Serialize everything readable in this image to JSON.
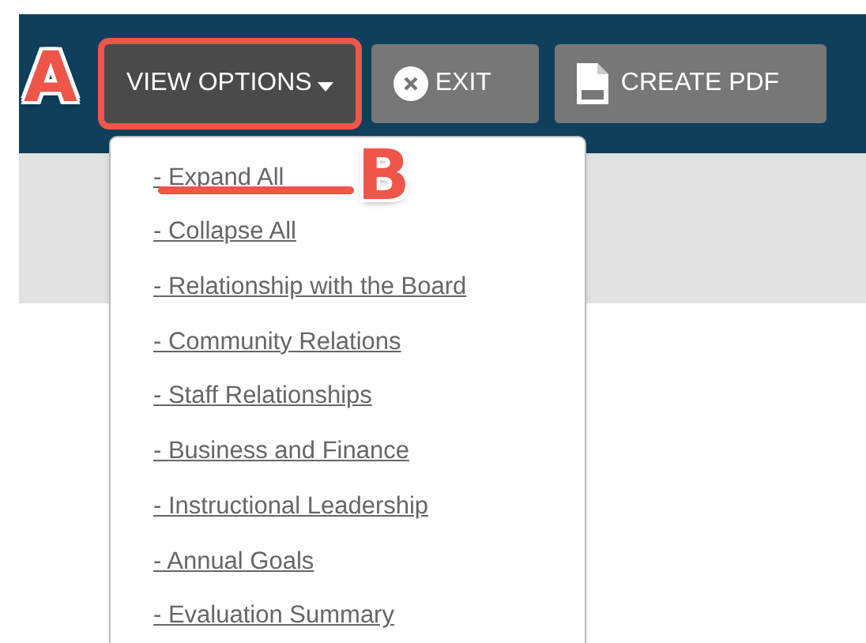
{
  "toolbar": {
    "buttons": [
      {
        "kind": "dropdown",
        "label": "VIEW OPTIONS",
        "highlighted": true
      },
      {
        "kind": "exit",
        "label": "EXIT",
        "highlighted": false
      },
      {
        "kind": "pdf",
        "label": "CREATE PDF",
        "highlighted": false
      }
    ]
  },
  "menu": {
    "items": [
      "- Expand All",
      "- Collapse All",
      "- Relationship with the Board",
      "- Community Relations",
      "- Staff Relationships",
      "- Business and Finance",
      "- Instructional Leadership",
      "- Annual Goals",
      "- Evaluation Summary"
    ]
  },
  "callouts": [
    {
      "label": "A",
      "kind": "button"
    },
    {
      "label": "B",
      "kind": "link"
    }
  ]
}
